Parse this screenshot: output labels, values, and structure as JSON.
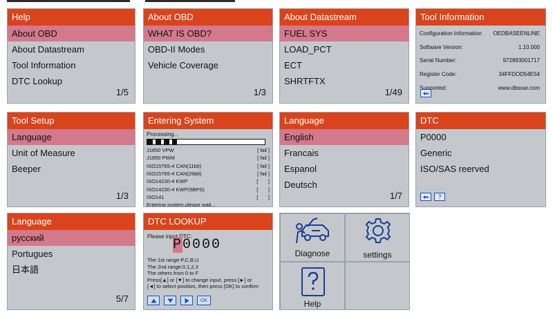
{
  "colors": {
    "header": "#d9441d",
    "selected": "#d4788b",
    "panel": "#c4c8cc",
    "button_blue": "#1f4fb0"
  },
  "help": {
    "title": "Help",
    "items": [
      "About OBD",
      "About Datastream",
      "Tool Information",
      "DTC Lookup"
    ],
    "pager": "1/5"
  },
  "about_obd": {
    "title": "About OBD",
    "items": [
      "WHAT IS OBD?",
      "OBD-II Modes",
      "Vehicle Coverage"
    ],
    "pager": "1/3"
  },
  "about_datastream": {
    "title": "About Datastream",
    "items": [
      "FUEL SYS",
      "LOAD_PCT",
      "ECT",
      "SHRTFTX"
    ],
    "pager": "1/49"
  },
  "tool_info": {
    "title": "Tool Information",
    "rows": [
      {
        "label": "Configuration Information",
        "value": "OEDBASEENLINE"
      },
      {
        "label": "Software Version:",
        "value": "1.10.000"
      },
      {
        "label": "Serial Number:",
        "value": "97289300171​7"
      },
      {
        "label": "Register Code:",
        "value": "34FFDOD54E54"
      },
      {
        "label": "Supported:",
        "value": "www.dbsoar.com"
      }
    ],
    "back_icon": "back-icon"
  },
  "tool_setup": {
    "title": "Tool Setup",
    "items": [
      "Language",
      "Unit of Measure",
      "Beeper"
    ],
    "pager": "1/3"
  },
  "entering_system": {
    "title": "Entering System",
    "processing": "Processing...",
    "progress": 0.25,
    "protocols": [
      {
        "name": "J1850 VPW",
        "status": "[ fail ]"
      },
      {
        "name": "J1850 PWM",
        "status": "[ fail ]"
      },
      {
        "name": "ISO15765-4 CAN(11bit)",
        "status": "[ fail ]"
      },
      {
        "name": "ISO15765-4 CAN(29bit)",
        "status": "[ fail ]"
      },
      {
        "name": "ISO14230-4 KWP",
        "status": "[       ]"
      },
      {
        "name": "ISO14230-4 KWP(5BPS)",
        "status": "[       ]"
      },
      {
        "name": "ISO141",
        "status": "[       ]"
      }
    ],
    "message": "Entering system,please wait..."
  },
  "language1": {
    "title": "Language",
    "items": [
      "English",
      "Francais",
      "Espanol",
      "Deutsch"
    ],
    "pager": "1/7"
  },
  "dtc": {
    "title": "DTC",
    "items": [
      "P0000",
      "Generic",
      "ISO/SAS reerved"
    ],
    "help_glyph": "?"
  },
  "language2": {
    "title": "Language",
    "items": [
      "русский",
      "Portugues",
      "日本語"
    ],
    "pager": "5/7"
  },
  "dtc_lookup": {
    "title": "DTC LOOKUP",
    "prompt": "Please input DTC:",
    "code_first": "P",
    "code_rest": "0000",
    "info": [
      "The 1st range:P,C,B,U",
      "The 2nd range:0,1,2,3",
      "The others from 0 to F",
      "Press[▲] or [▼] to change input, press [►] or",
      "[◄] to select position, then press [OK] to confirm"
    ],
    "ok_label": "OK"
  },
  "home": {
    "diagnose": "Diagnose",
    "settings": "settings",
    "help": "Help"
  }
}
